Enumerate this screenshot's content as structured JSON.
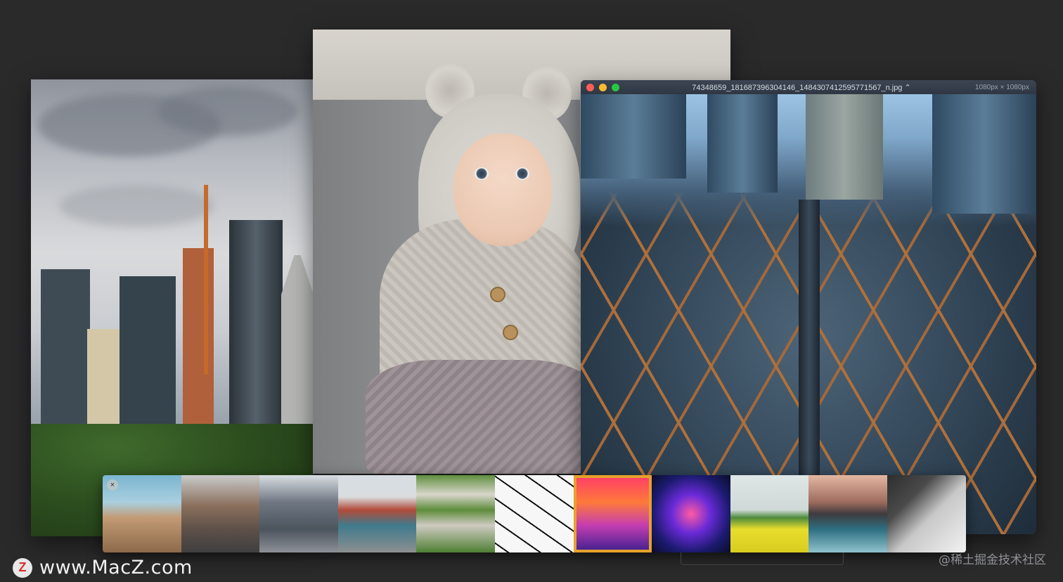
{
  "viewer_window": {
    "title": "74348659_181687396304146_1484307412595771567_n.jpg",
    "title_chevron": "⌃",
    "size_label": "1080px × 1080px",
    "traffic_colors": [
      "#ff5f57",
      "#febc2e",
      "#28c840"
    ]
  },
  "controls": {
    "zoom_out": "⊖",
    "zoom_in": "⊕",
    "prev": "←",
    "play": "▶",
    "next": "→",
    "fit": "[ ]",
    "fullscreen": "↗"
  },
  "thumbnails": [
    {
      "name": "thumb-rocks",
      "bg": "linear-gradient(180deg,#7bb5cf 0%,#a9cfe0 35%,#c29a74 55%,#8e6a4a 100%)"
    },
    {
      "name": "thumb-bridge-street",
      "bg": "linear-gradient(180deg,#c9c9c9 0%,#8a6f5c 40%,#5e5049 70%,#3f3f40 100%)"
    },
    {
      "name": "thumb-city-street",
      "bg": "linear-gradient(180deg,#d8dde2 0%,#6f7782 35%,#4c545e 70%,#8d9096 100%)"
    },
    {
      "name": "thumb-townhouses",
      "bg": "linear-gradient(180deg,#d7dde3 0%,#d9dde0 28%,#b24b3a 45%,#3f7a8c 65%,#8e8f90 100%)"
    },
    {
      "name": "thumb-green-building",
      "bg": "linear-gradient(180deg,#5f8f3d 0%,#d9d6cc 25%,#5d8c3a 45%,#cfcbc1 65%,#4e7f33 100%)"
    },
    {
      "name": "thumb-geometric-lines",
      "bg": "repeating-linear-gradient(35deg,#f7f7f7 0 10px,#111 10px 12px,#f7f7f7 12px 26px)"
    },
    {
      "name": "thumb-neon-corridor",
      "bg": "linear-gradient(180deg,#ff3b6b 0%,#ff7a3a 35%,#c43db1 65%,#3a1f8f 100%)",
      "selected": true
    },
    {
      "name": "thumb-neon-tunnel",
      "bg": "radial-gradient(circle at 50% 50%,#ff5aa5 0%,#6a2ad8 35%,#1b1a6e 70%,#0b0d2a 100%)"
    },
    {
      "name": "thumb-yellow-field",
      "bg": "linear-gradient(180deg,#dfe6e6 0%,#cfd9d7 45%,#4c8a3b 55%,#e8dc2c 70%,#d8cc1f 100%)"
    },
    {
      "name": "thumb-mountain-lake",
      "bg": "linear-gradient(180deg,#e4b7a2 0%,#9d6b5e 35%,#3f3b3e 50%,#2e6f82 70%,#8fc3cc 100%)"
    },
    {
      "name": "thumb-phone-keyboard",
      "bg": "linear-gradient(135deg,#2e2e2e 0%,#4a4a4a 30%,#c8c8c8 55%,#f2f2f2 100%)"
    }
  ],
  "watermarks": {
    "macz": "www.MacZ.com",
    "juejin": "@稀土掘金技术社区"
  }
}
